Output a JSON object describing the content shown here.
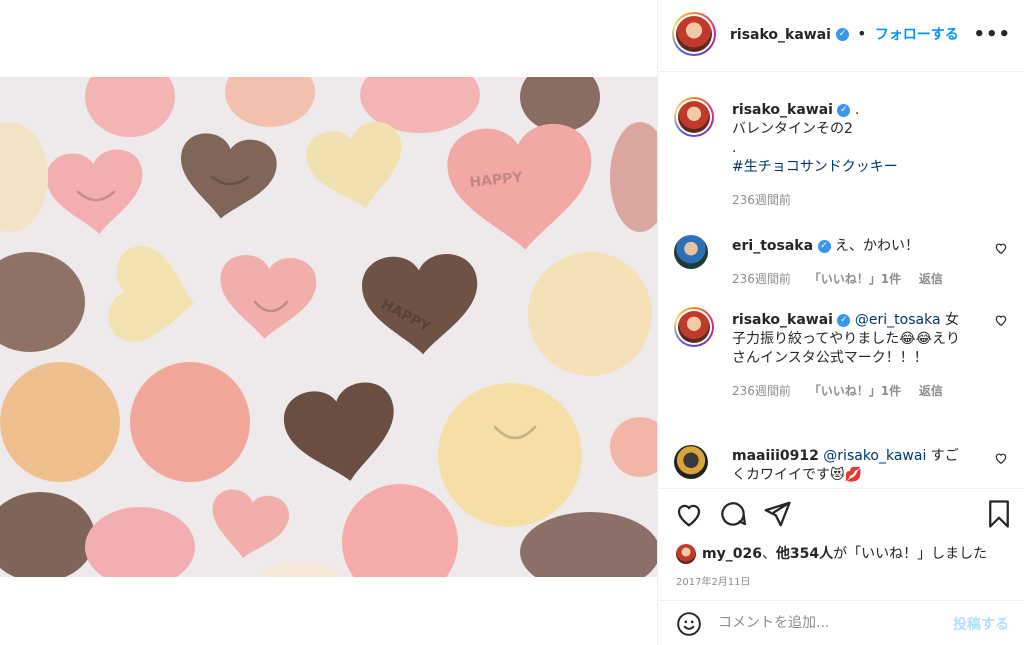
{
  "header": {
    "username": "risako_kawai",
    "separator": "•",
    "follow_label": "フォローする",
    "more": "•••"
  },
  "caption": {
    "username": "risako_kawai",
    "dot": ".",
    "line1": "バレンタインその2",
    "line2": ".",
    "hashtag": "#生チョコサンドクッキー",
    "time": "236週間前"
  },
  "comments": [
    {
      "username": "eri_tosaka",
      "text": "え、かわい！",
      "time": "236週間前",
      "likes": "「いいね！」1件",
      "reply": "返信"
    },
    {
      "username": "risako_kawai",
      "mention": "@eri_tosaka",
      "text": " 女子力振り絞ってやりました😂😂えりさんインスタ公式マーク！！！",
      "time": "236週間前",
      "likes": "「いいね！」1件",
      "reply": "返信"
    },
    {
      "username": "maaiii0912",
      "mention": "@risako_kawai",
      "text": " すごくカワイイです😻💋"
    }
  ],
  "likes": {
    "user": "my_026",
    "sep": "、",
    "others": "他354人",
    "suffix": "が「いいね！」しました"
  },
  "date": "2017年2月11日",
  "comment_box": {
    "placeholder": "コメントを追加...",
    "post_label": "投稿する"
  },
  "icons": {
    "heart": "heart-icon",
    "comment": "comment-icon",
    "share": "share-icon",
    "save": "bookmark-icon",
    "emoji": "emoji-icon",
    "more": "more-icon"
  },
  "colors": {
    "accent": "#0095f6",
    "verified": "#3897f0",
    "link": "#00376b",
    "muted": "#8e8e8e"
  }
}
